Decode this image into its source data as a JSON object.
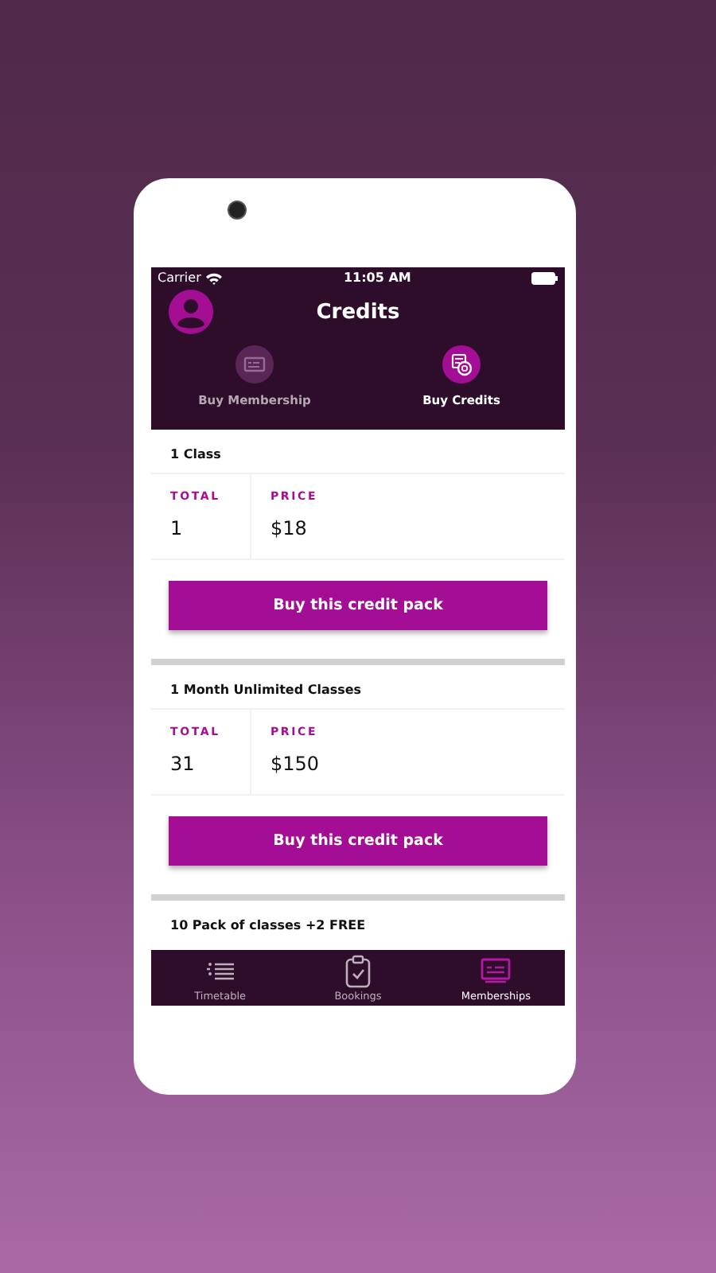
{
  "status_bar": {
    "carrier": "Carrier",
    "time": "11:05 AM"
  },
  "header": {
    "title": "Credits"
  },
  "tabs": [
    {
      "label": "Buy Membership",
      "selected": false
    },
    {
      "label": "Buy Credits",
      "selected": true
    }
  ],
  "packs": [
    {
      "title": "1 Class",
      "total_label": "TOTAL",
      "total": "1",
      "price_label": "PRICE",
      "price": "$18",
      "button": "Buy this credit pack"
    },
    {
      "title": "1 Month Unlimited Classes",
      "total_label": "TOTAL",
      "total": "31",
      "price_label": "PRICE",
      "price": "$150",
      "button": "Buy this credit pack"
    },
    {
      "title": "10 Pack of classes +2 FREE"
    }
  ],
  "tab_bar": [
    {
      "label": "Timetable",
      "selected": false
    },
    {
      "label": "Bookings",
      "selected": false
    },
    {
      "label": "Memberships",
      "selected": true
    }
  ]
}
